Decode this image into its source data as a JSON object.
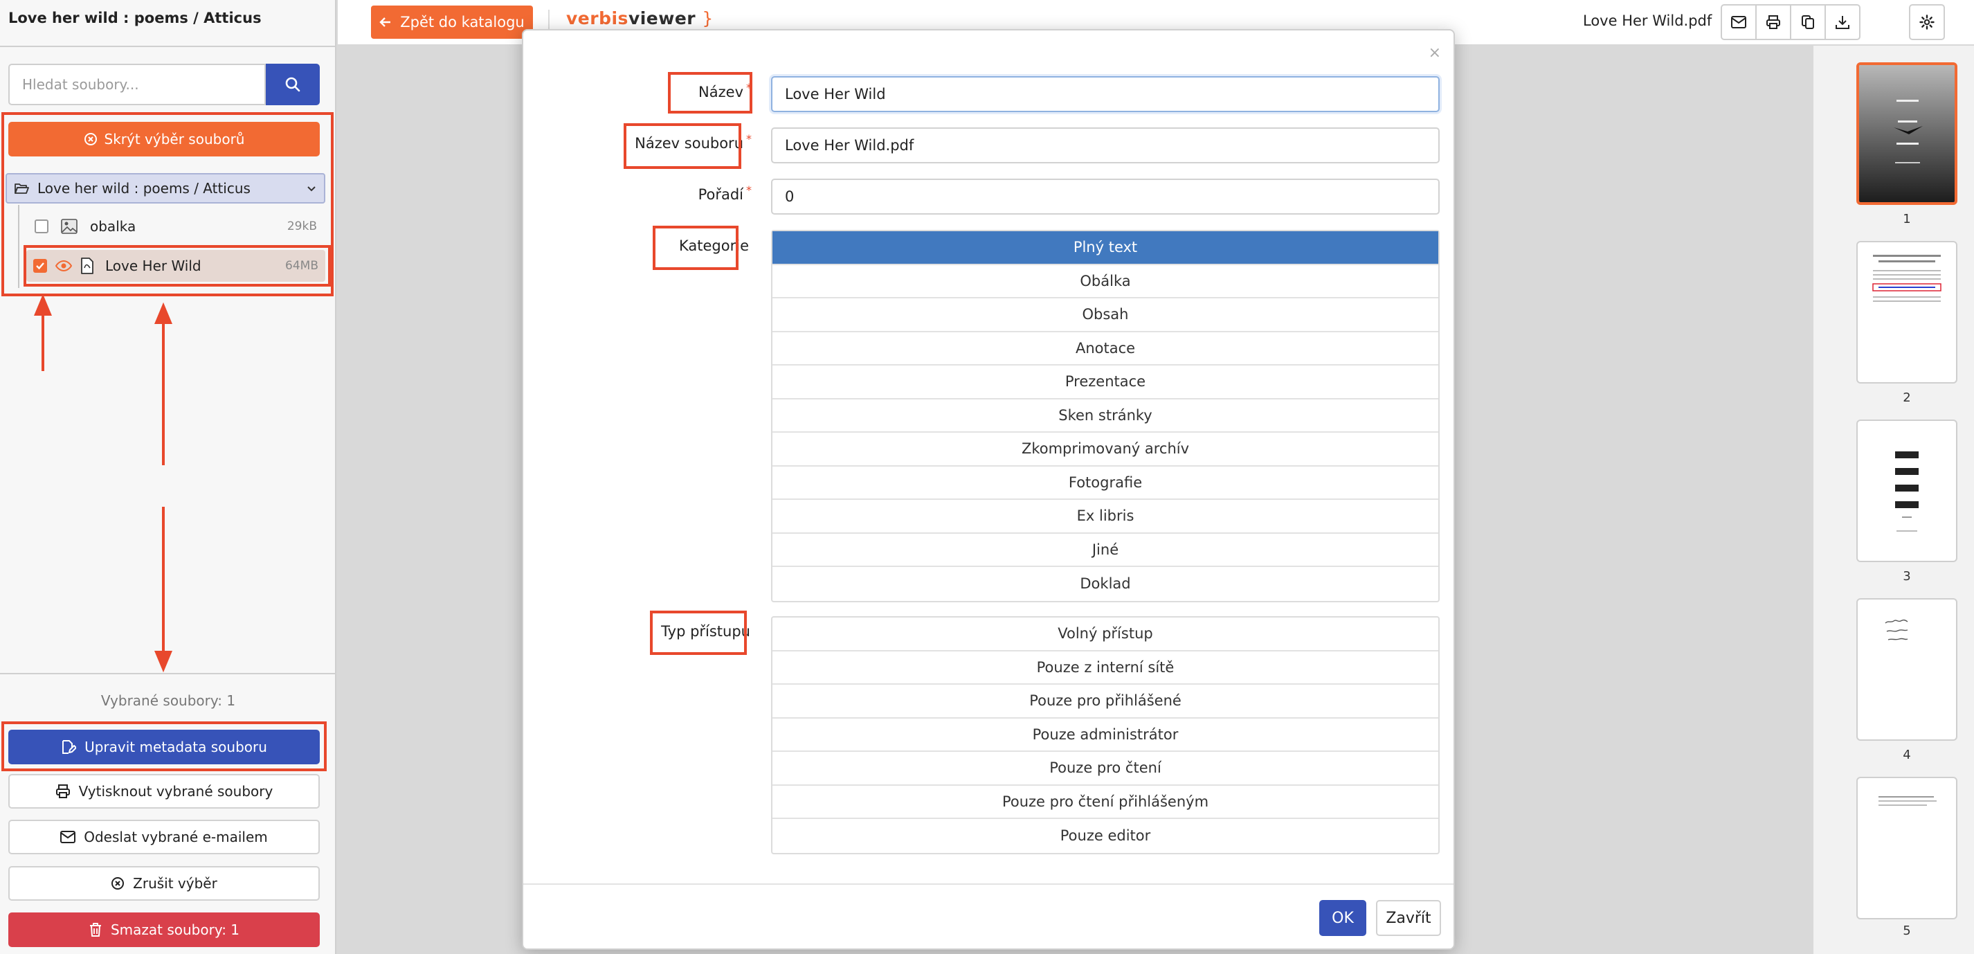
{
  "sidebar": {
    "title": "Love her wild : poems / Atticus",
    "search_placeholder": "Hledat soubory...",
    "hide_label": "Skrýt výběr souborů",
    "folder_label": "Love her wild : poems / Atticus",
    "files": [
      {
        "name": "obalka",
        "size": "29kB",
        "checked": false
      },
      {
        "name": "Love Her Wild",
        "size": "64MB",
        "checked": true
      }
    ],
    "selected_count": "Vybrané soubory: 1",
    "actions": {
      "edit": "Upravit metadata souboru",
      "print": "Vytisknout vybrané soubory",
      "email": "Odeslat vybrané e-mailem",
      "cancel": "Zrušit výběr",
      "delete": "Smazat soubory: 1"
    }
  },
  "topbar": {
    "back_label": "Zpět do katalogu",
    "logo_part1": "verbis",
    "logo_part2": "viewer",
    "logo_brace": "}",
    "doc_title": "Love Her Wild.pdf"
  },
  "thumbnails": [
    "1",
    "2",
    "3",
    "4",
    "5"
  ],
  "modal": {
    "close_symbol": "×",
    "labels": {
      "name": "Název",
      "filename": "Název souboru",
      "order": "Pořadí",
      "category": "Kategorie",
      "access": "Typ přístupu",
      "required_mark": "*"
    },
    "values": {
      "name": "Love Her Wild",
      "filename": "Love Her Wild.pdf",
      "order": "0"
    },
    "categories": [
      "Plný text",
      "Obálka",
      "Obsah",
      "Anotace",
      "Prezentace",
      "Sken stránky",
      "Zkomprimovaný archív",
      "Fotografie",
      "Ex libris",
      "Jiné",
      "Doklad"
    ],
    "active_category": "Plný text",
    "access_types": [
      "Volný přístup",
      "Pouze z interní sítě",
      "Pouze pro přihlášené",
      "Pouze administrátor",
      "Pouze pro čtení",
      "Pouze pro čtení přihlášeným",
      "Pouze editor"
    ],
    "ok_label": "OK",
    "close_label": "Zavřít"
  },
  "colors": {
    "accent_orange": "#f26a33",
    "primary_blue": "#3753b8",
    "active_category": "#4179bf",
    "danger_red": "#d9404b",
    "annotation_red": "#e8482c"
  }
}
